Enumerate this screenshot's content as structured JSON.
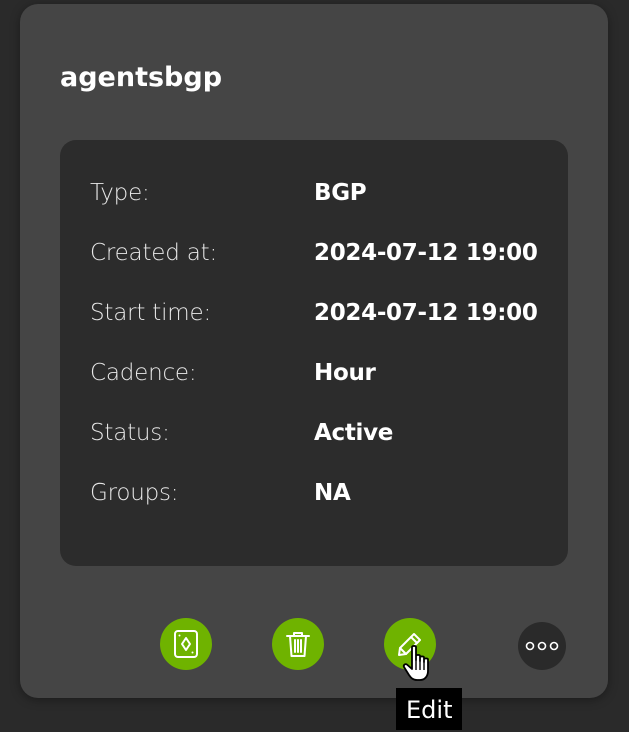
{
  "card": {
    "title": "agentsbgp"
  },
  "details": [
    {
      "label": "Type:",
      "value": "BGP"
    },
    {
      "label": "Created at:",
      "value": "2024-07-12 19:00"
    },
    {
      "label": "Start time:",
      "value": "2024-07-12 19:00"
    },
    {
      "label": "Cadence:",
      "value": "Hour"
    },
    {
      "label": "Status:",
      "value": "Active"
    },
    {
      "label": "Groups:",
      "value": "NA"
    }
  ],
  "actions": [
    {
      "name": "report",
      "icon": "playing-card-icon",
      "color": "#6fb300"
    },
    {
      "name": "delete",
      "icon": "trash-icon",
      "color": "#6fb300"
    },
    {
      "name": "edit",
      "icon": "pencil-icon",
      "color": "#6fb300"
    },
    {
      "name": "more",
      "icon": "more-horizontal-icon",
      "color": "#2a2a2a"
    }
  ],
  "tooltip": {
    "text": "Edit"
  },
  "colors": {
    "page_background": "#2a2a2a",
    "card_background": "#454545",
    "panel_background": "#2c2c2c",
    "accent": "#6fb300"
  }
}
